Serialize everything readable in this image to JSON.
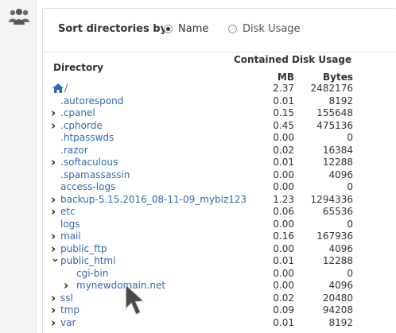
{
  "sort": {
    "label": "Sort directories by:",
    "options": [
      {
        "label": "Name",
        "selected": true
      },
      {
        "label": "Disk Usage",
        "selected": false
      }
    ]
  },
  "table": {
    "directory_header": "Directory",
    "usage_header": "Contained Disk Usage",
    "mb_header": "MB",
    "bytes_header": "Bytes",
    "rows": [
      {
        "name": "/",
        "home": true,
        "expandable": false,
        "expanded": false,
        "indent": 0,
        "mb": "2.37",
        "bytes": "2482176"
      },
      {
        "name": ".autorespond",
        "expandable": false,
        "expanded": false,
        "indent": 1,
        "mb": "0.01",
        "bytes": "8192"
      },
      {
        "name": ".cpanel",
        "expandable": true,
        "expanded": false,
        "indent": 1,
        "mb": "0.15",
        "bytes": "155648"
      },
      {
        "name": ".cphorde",
        "expandable": true,
        "expanded": false,
        "indent": 1,
        "mb": "0.45",
        "bytes": "475136"
      },
      {
        "name": ".htpasswds",
        "expandable": false,
        "expanded": false,
        "indent": 1,
        "mb": "0.00",
        "bytes": "0"
      },
      {
        "name": ".razor",
        "expandable": false,
        "expanded": false,
        "indent": 1,
        "mb": "0.02",
        "bytes": "16384"
      },
      {
        "name": ".softaculous",
        "expandable": true,
        "expanded": false,
        "indent": 1,
        "mb": "0.01",
        "bytes": "12288"
      },
      {
        "name": ".spamassassin",
        "expandable": false,
        "expanded": false,
        "indent": 1,
        "mb": "0.00",
        "bytes": "4096"
      },
      {
        "name": "access-logs",
        "expandable": false,
        "expanded": false,
        "indent": 1,
        "mb": "0.00",
        "bytes": "0"
      },
      {
        "name": "backup-5.15.2016_08-11-09_mybiz123",
        "expandable": true,
        "expanded": false,
        "indent": 1,
        "mb": "1.23",
        "bytes": "1294336"
      },
      {
        "name": "etc",
        "expandable": true,
        "expanded": false,
        "indent": 1,
        "mb": "0.06",
        "bytes": "65536"
      },
      {
        "name": "logs",
        "expandable": false,
        "expanded": false,
        "indent": 1,
        "mb": "0.00",
        "bytes": "0"
      },
      {
        "name": "mail",
        "expandable": true,
        "expanded": false,
        "indent": 1,
        "mb": "0.16",
        "bytes": "167936"
      },
      {
        "name": "public_ftp",
        "expandable": true,
        "expanded": false,
        "indent": 1,
        "mb": "0.00",
        "bytes": "4096"
      },
      {
        "name": "public_html",
        "expandable": true,
        "expanded": true,
        "indent": 1,
        "mb": "0.01",
        "bytes": "12288"
      },
      {
        "name": "cgi-bin",
        "expandable": false,
        "expanded": false,
        "indent": 2,
        "mb": "0.00",
        "bytes": "0"
      },
      {
        "name": "mynewdomain.net",
        "expandable": true,
        "expanded": false,
        "indent": 2,
        "mb": "0.00",
        "bytes": "4096"
      },
      {
        "name": "ssl",
        "expandable": true,
        "expanded": false,
        "indent": 1,
        "mb": "0.02",
        "bytes": "20480"
      },
      {
        "name": "tmp",
        "expandable": true,
        "expanded": false,
        "indent": 1,
        "mb": "0.09",
        "bytes": "94208"
      },
      {
        "name": "var",
        "expandable": true,
        "expanded": false,
        "indent": 1,
        "mb": "0.01",
        "bytes": "8192"
      }
    ]
  },
  "icons": {
    "rail": "users-icon",
    "home": "home-icon",
    "collapsed": "chevron-right-icon",
    "expanded": "chevron-down-icon",
    "pointer": "mouse-cursor-icon"
  }
}
